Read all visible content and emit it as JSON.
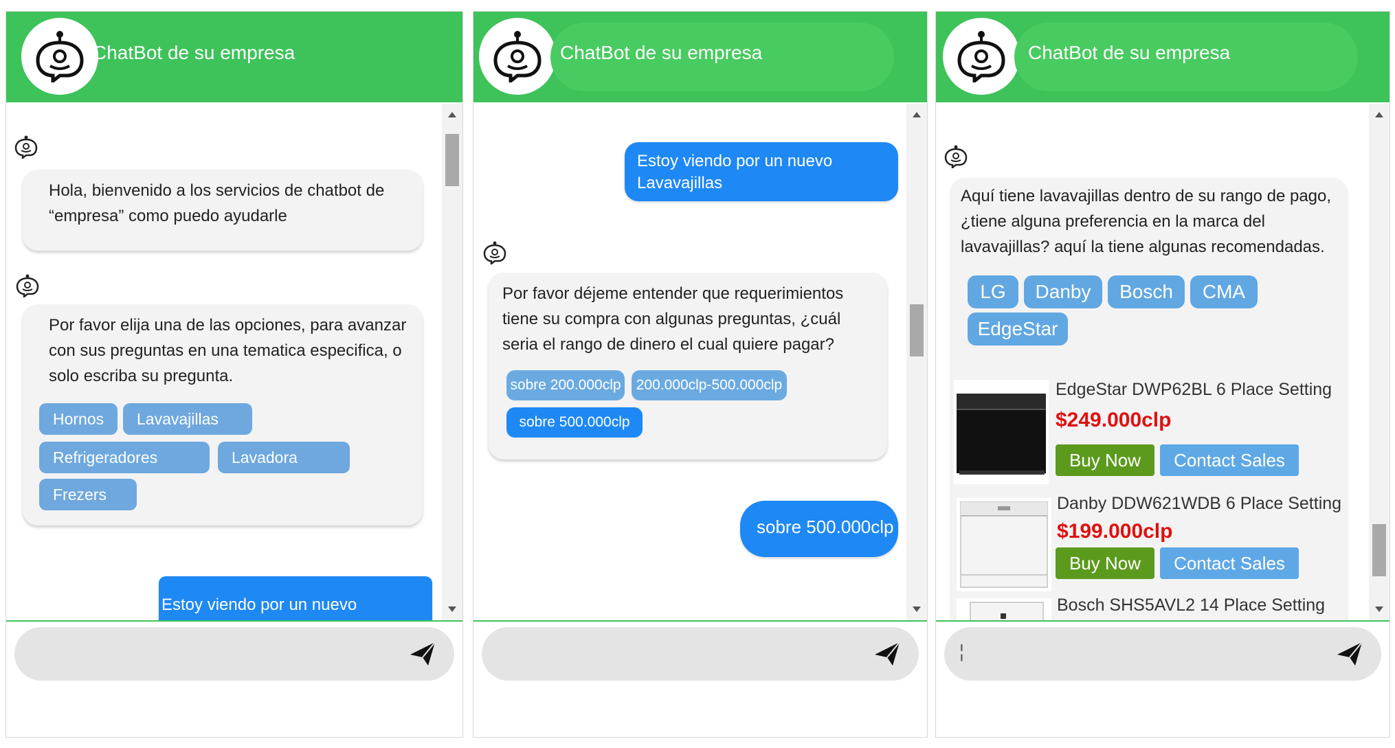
{
  "app": {
    "title": "ChatBot de su empresa"
  },
  "colors": {
    "header": "#3dc35a",
    "user_bubble": "#1e88f5",
    "chip": "#6ea8de",
    "buy_button": "#5c9a1e",
    "contact_button": "#5fa8e6",
    "price": "#e01010"
  },
  "icons": {
    "avatar": "chatbot-avatar-icon",
    "bot": "bot-icon",
    "send": "paper-plane-icon"
  },
  "panel1": {
    "msg1": "Hola, bienvenido a los servicios de chatbot de “empresa” como puedo ayudarle",
    "msg2": "Por favor elija una de las opciones, para avanzar con sus preguntas en una tematica especifica, o solo escriba su pregunta.",
    "options": [
      "Hornos",
      "Lavavajillas",
      "Refrigeradores",
      "Lavadora",
      "Frezers"
    ],
    "user_msg": "Estoy viendo por un nuevo"
  },
  "panel2": {
    "user_msg": "Estoy viendo por un nuevo Lavavajillas",
    "msg": "Por favor déjeme entender que requerimientos tiene su compra con algunas preguntas, ¿cuál seria el rango de dinero el cual quiere pagar?",
    "options": [
      "sobre 200.000clp",
      "200.000clp-500.000clp",
      "sobre 500.000clp"
    ],
    "user_reply": "sobre 500.000clp"
  },
  "panel3": {
    "msg": "Aquí tiene lavavajillas dentro de su rango de pago, ¿tiene alguna preferencia en la marca del lavavajillas? aquí la tiene algunas recomendadas.",
    "brands": [
      "LG",
      "Danby",
      "Bosch",
      "CMA",
      "EdgeStar"
    ],
    "products": [
      {
        "name": "EdgeStar DWP62BL 6 Place Setting",
        "price": "$249.000clp"
      },
      {
        "name": "Danby DDW621WDB 6 Place Setting",
        "price": "$199.000clp"
      },
      {
        "name": "Bosch SHS5AVL2 14 Place Setting",
        "price": ""
      }
    ],
    "buy_label": "Buy Now",
    "contact_label": "Contact Sales",
    "input_value": "¦"
  }
}
